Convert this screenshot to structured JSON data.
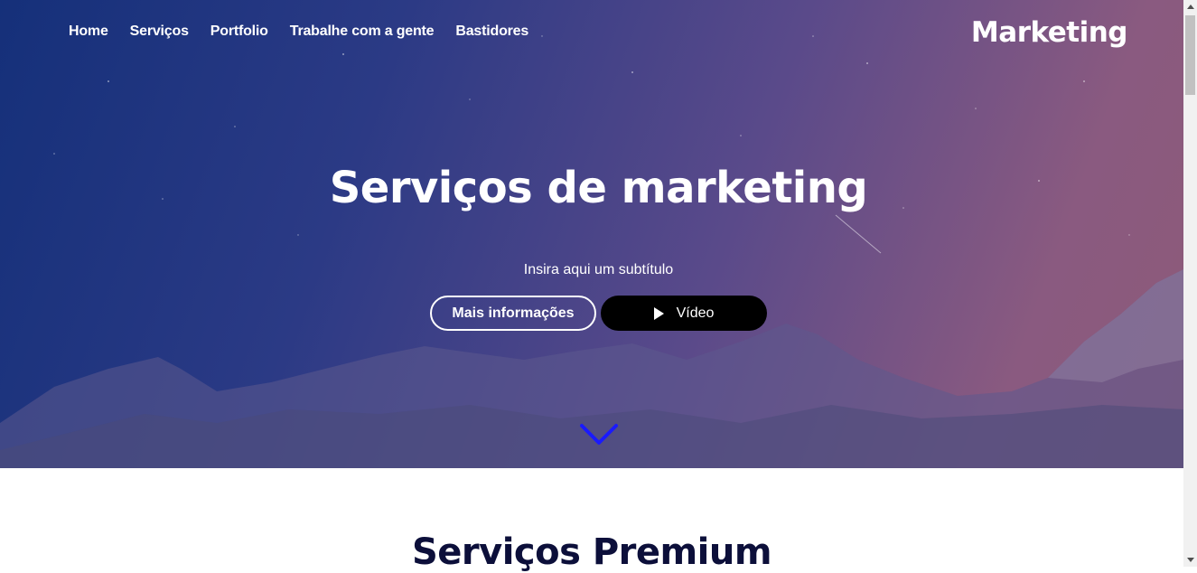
{
  "nav": {
    "items": [
      {
        "label": "Home"
      },
      {
        "label": "Serviços"
      },
      {
        "label": "Portfolio"
      },
      {
        "label": "Trabalhe com a gente"
      },
      {
        "label": "Bastidores"
      }
    ]
  },
  "brand": {
    "logo_text": "Marketing"
  },
  "hero": {
    "title": "Serviços de marketing",
    "subtitle": "Insira aqui um subtítulo",
    "primary_button": "Mais informações",
    "video_button": "Vídeo",
    "scroll_icon": "chevron-down-icon"
  },
  "section": {
    "title": "Serviços Premium"
  },
  "colors": {
    "hero_gradient_start": "#15307a",
    "hero_gradient_end": "#8d5a78",
    "chevron": "#1a1aff",
    "section_title": "#0c0f3a",
    "video_button_bg": "#000000"
  }
}
